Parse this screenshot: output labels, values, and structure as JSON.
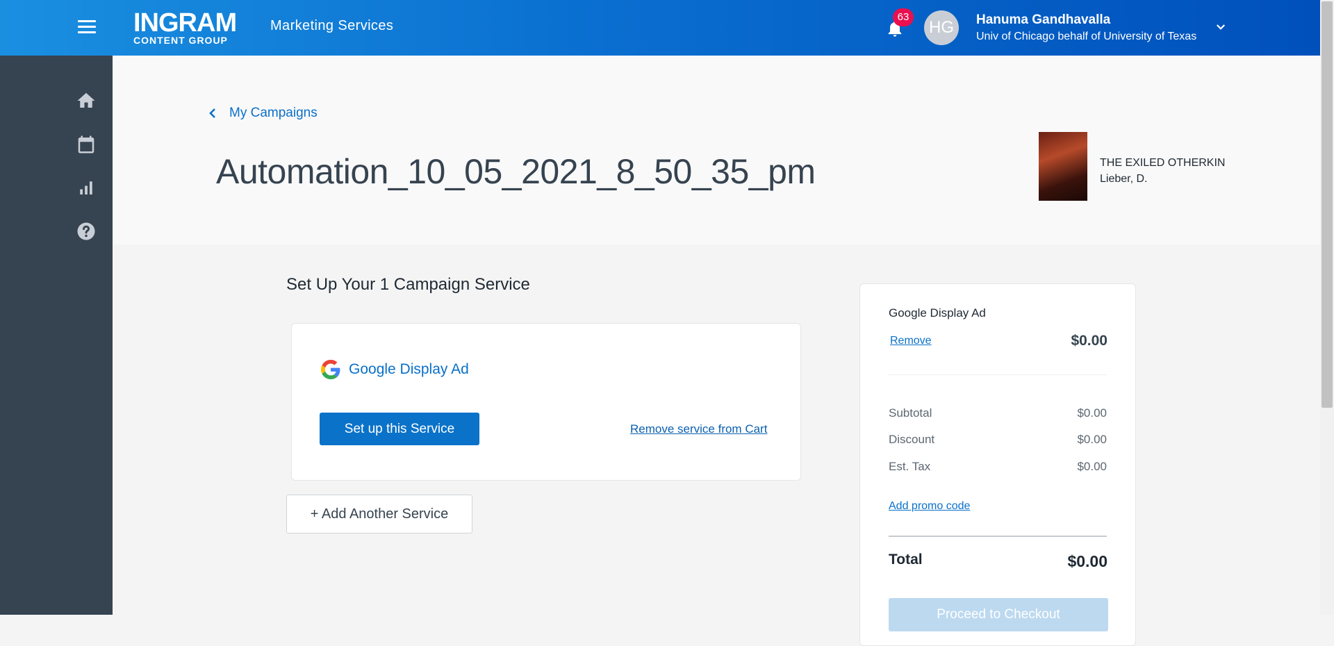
{
  "header": {
    "logo_main": "INGRAM",
    "logo_sub": "CONTENT GROUP",
    "app_name": "Marketing Services",
    "notification_count": "63",
    "user_initials": "HG",
    "user_name": "Hanuma Gandhavalla",
    "user_org": "Univ of Chicago behalf of University of Texas"
  },
  "sidebar": {
    "items": [
      {
        "icon": "home-icon"
      },
      {
        "icon": "calendar-icon"
      },
      {
        "icon": "bar-chart-icon"
      },
      {
        "icon": "help-icon"
      }
    ]
  },
  "campaign": {
    "back_label": "My Campaigns",
    "title": "Automation_10_05_2021_8_50_35_pm",
    "book_title": "THE EXILED OTHERKIN",
    "book_author": "Lieber, D."
  },
  "services": {
    "section_title": "Set Up Your 1 Campaign Service",
    "service_name": "Google Display Ad",
    "setup_label": "Set up this Service",
    "remove_label": "Remove service from Cart",
    "add_label": "+ Add Another Service"
  },
  "summary": {
    "service_name": "Google Display Ad",
    "remove_label": "Remove",
    "service_price": "$0.00",
    "subtotal_label": "Subtotal",
    "subtotal": "$0.00",
    "discount_label": "Discount",
    "discount": "$0.00",
    "tax_label": "Est. Tax",
    "tax": "$0.00",
    "promo_label": "Add promo code",
    "total_label": "Total",
    "total": "$0.00",
    "checkout_label": "Proceed to Checkout"
  },
  "colors": {
    "brand_blue": "#0a72c9",
    "sidebar": "#364350",
    "badge": "#e8104f"
  }
}
